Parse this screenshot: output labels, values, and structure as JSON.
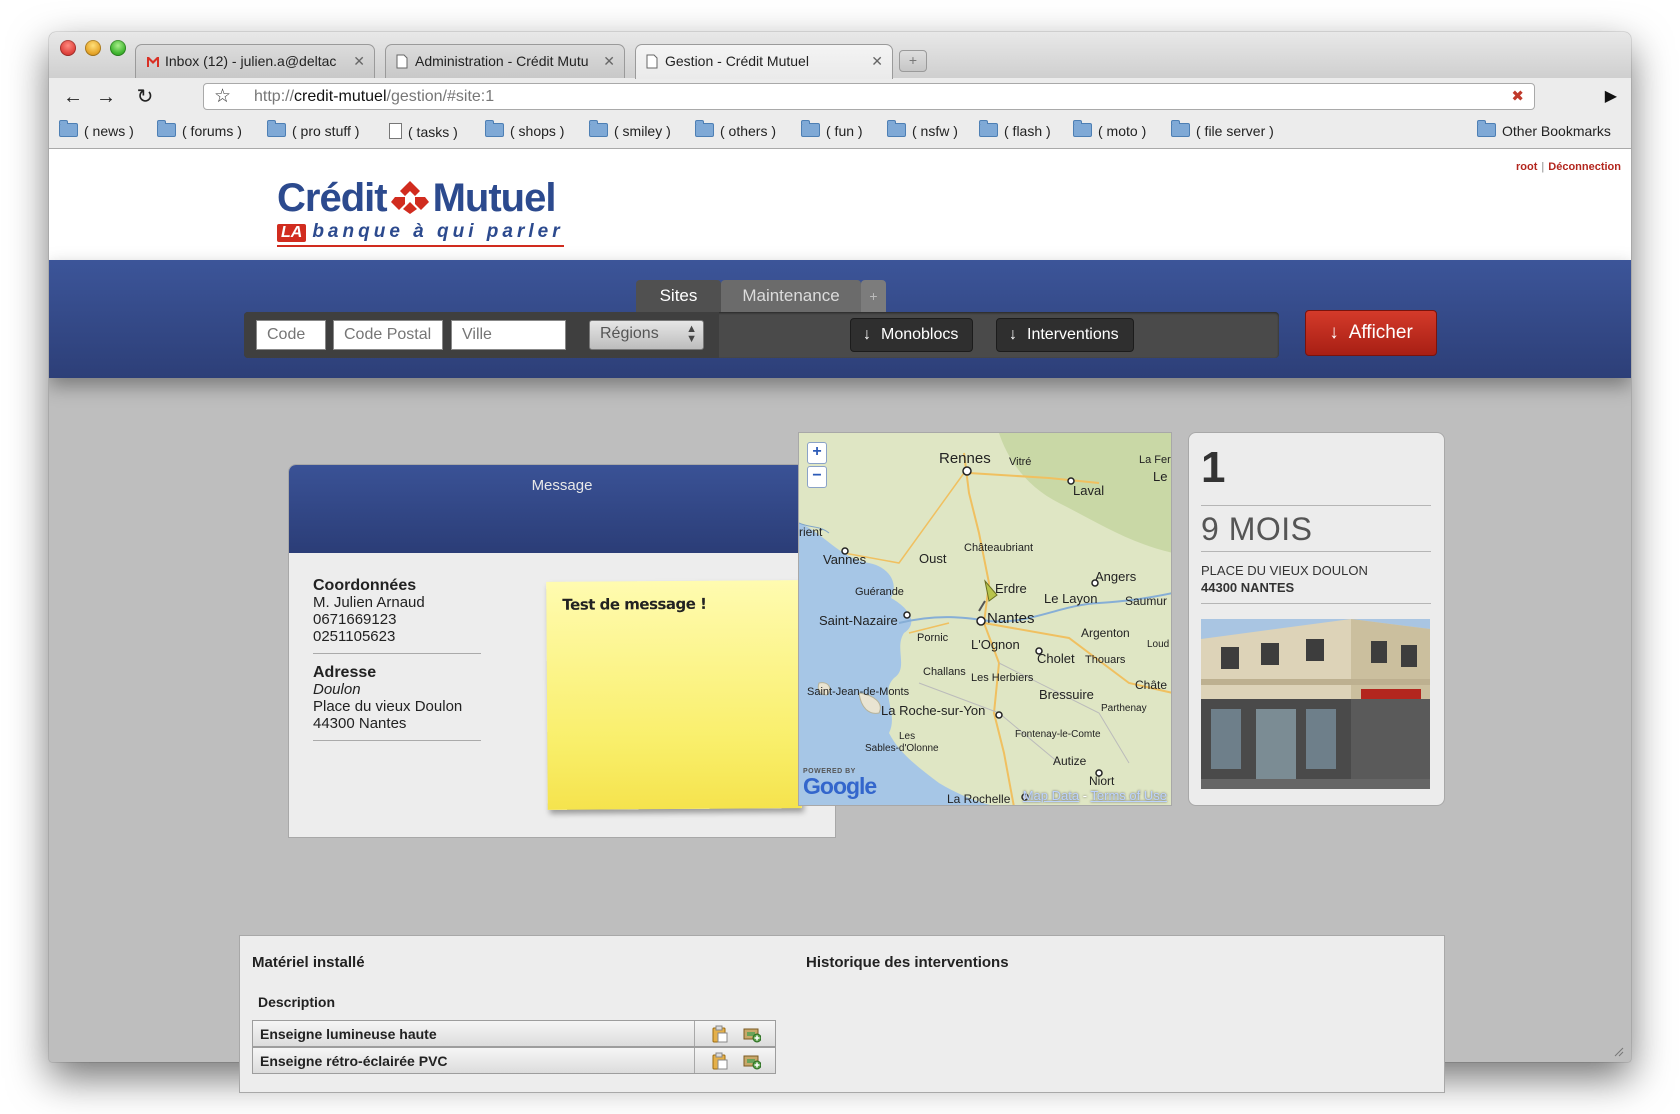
{
  "browser": {
    "tabs": [
      {
        "title": "Inbox (12) - julien.a@deltac",
        "favicon": "gmail-icon",
        "active": false
      },
      {
        "title": "Administration - Crédit Mutu",
        "favicon": "page-icon",
        "active": false
      },
      {
        "title": "Gestion - Crédit Mutuel",
        "favicon": "page-icon",
        "active": true
      }
    ],
    "url_scheme": "http://",
    "url_host": "credit-mutuel",
    "url_path": "/gestion/#site:1",
    "bookmarks": [
      "( news )",
      "( forums )",
      "( pro stuff )",
      "( tasks )",
      "( shops )",
      "( smiley )",
      "( others )",
      "( fun )",
      "( nsfw )",
      "( flash )",
      "( moto )",
      "( file server )"
    ],
    "other_bookmarks": "Other Bookmarks"
  },
  "header": {
    "logo_credit": "Crédit",
    "logo_mutuel": "Mutuel",
    "logo_la": "LA",
    "logo_tagline": "banque à qui parler",
    "user": "root",
    "logout": "Déconnection"
  },
  "nav": {
    "tab_sites": "Sites",
    "tab_maintenance": "Maintenance",
    "tab_add": "+",
    "code_placeholder": "Code",
    "postal_placeholder": "Code Postal",
    "city_placeholder": "Ville",
    "regions_label": "Régions",
    "monoblocs_label": "Monoblocs",
    "interventions_label": "Interventions",
    "afficher_label": "Afficher"
  },
  "message": {
    "title": "Message",
    "coords_heading": "Coordonnées",
    "name": "M. Julien Arnaud",
    "phone1": "0671669123",
    "phone2": "0251105623",
    "address_heading": "Adresse",
    "address_place": "Doulon",
    "address_street": "Place du vieux Doulon",
    "address_city": "44300 Nantes",
    "note": "Test de message !"
  },
  "map": {
    "cities": [
      "Rennes",
      "Vitré",
      "La Fer",
      "Le",
      "Laval",
      "rient",
      "Vannes",
      "Oust",
      "Châteaubriant",
      "Guérande",
      "Erdre",
      "Angers",
      "Le Layon",
      "Saumur",
      "Saint-Nazaire",
      "Nantes",
      "Pornic",
      "L'Ognon",
      "Argenton",
      "Loud",
      "Cholet",
      "Thouars",
      "Challans",
      "Les Herbiers",
      "Châte",
      "Saint-Jean-de-Monts",
      "Bressuire",
      "Parthenay",
      "La Roche-sur-Yon",
      "Les",
      "Sables-d'Olonne",
      "Fontenay-le-Comte",
      "Autize",
      "Niort",
      "La Rochelle"
    ],
    "powered_by": "POWERED BY",
    "google": "Google",
    "map_data": "Map Data",
    "terms": "Terms of Use",
    "zoom_in": "+",
    "zoom_out": "−"
  },
  "stats": {
    "count": "1",
    "duration": "9 MOIS",
    "address_line1": "PLACE DU VIEUX DOULON",
    "address_line2": "44300 NANTES"
  },
  "equipment": {
    "title": "Matériel installé",
    "description_header": "Description",
    "rows": [
      "Enseigne lumineuse haute",
      "Enseigne rétro-éclairée PVC"
    ]
  },
  "history": {
    "title": "Historique des interventions"
  }
}
